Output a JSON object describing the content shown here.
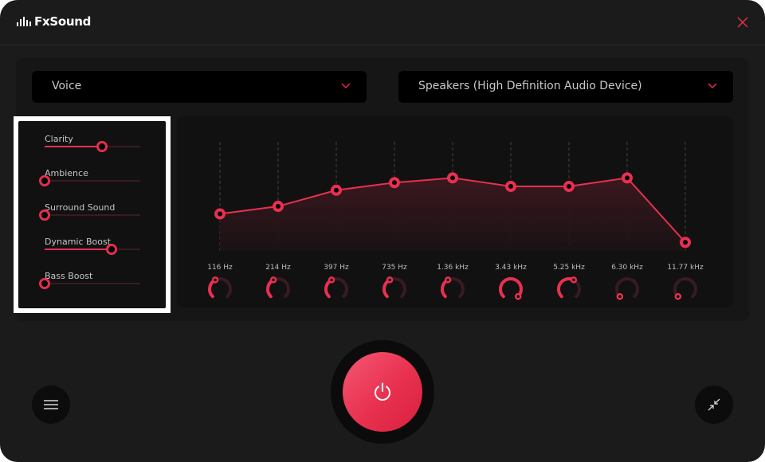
{
  "app": {
    "title": "FxSound",
    "logo_icon": "equalizer-bars-icon",
    "close_icon": "close-icon"
  },
  "colors": {
    "accent": "#e8304f",
    "accent_dim": "#3a1a21",
    "background": "#1b1b1b",
    "panel": "#161616",
    "inner_panel": "#111111",
    "text": "#c9c9c9"
  },
  "preset_dropdown": {
    "selected": "Voice",
    "icon": "chevron-down-icon"
  },
  "output_dropdown": {
    "selected": "Speakers (High Definition Audio Device)",
    "icon": "chevron-down-icon"
  },
  "effects": [
    {
      "label": "Clarity",
      "value": 0.6
    },
    {
      "label": "Ambience",
      "value": 0.0
    },
    {
      "label": "Surround Sound",
      "value": 0.0
    },
    {
      "label": "Dynamic Boost",
      "value": 0.7
    },
    {
      "label": "Bass Boost",
      "value": 0.0
    }
  ],
  "equalizer": {
    "bands": [
      {
        "label": "116 Hz",
        "gain": 0.34,
        "knob": 0.4
      },
      {
        "label": "214 Hz",
        "gain": 0.42,
        "knob": 0.4
      },
      {
        "label": "397 Hz",
        "gain": 0.59,
        "knob": 0.4
      },
      {
        "label": "735 Hz",
        "gain": 0.67,
        "knob": 0.4
      },
      {
        "label": "1.36 kHz",
        "gain": 0.72,
        "knob": 0.4
      },
      {
        "label": "3.43 kHz",
        "gain": 0.63,
        "knob": 1.0
      },
      {
        "label": "5.25 kHz",
        "gain": 0.63,
        "knob": 0.6
      },
      {
        "label": "6.30 kHz",
        "gain": 0.72,
        "knob": 0.0
      },
      {
        "label": "11.77 kHz",
        "gain": 0.04,
        "knob": 0.0
      }
    ]
  },
  "controls": {
    "power_icon": "power-icon",
    "power_state": "on",
    "menu_icon": "hamburger-menu-icon",
    "minimize_icon": "collapse-arrows-icon"
  }
}
